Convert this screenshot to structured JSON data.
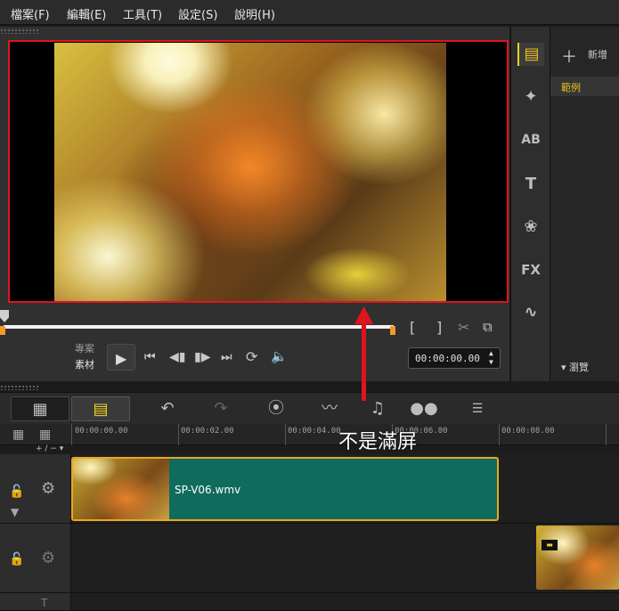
{
  "menu": {
    "file": "檔案(F)",
    "edit": "編輯(E)",
    "tools": "工具(T)",
    "settings": "設定(S)",
    "help": "說明(H)"
  },
  "player": {
    "mode_project": "專案",
    "mode_clip": "素材",
    "timecode": "00:00:00.00",
    "trim_start": "[",
    "trim_end": "]"
  },
  "library": {
    "add_label": "新增",
    "sample_label": "範例",
    "browse_label": "瀏覽"
  },
  "timeline": {
    "ticks": [
      "00:00:00.00",
      "00:00:02.00",
      "00:00:04.00",
      "00:00:06.00",
      "00:00:08.00"
    ],
    "clip_name": "SP-V06.wmv",
    "zoom_controls": "+ / − ▾"
  },
  "annotation": {
    "text": "不是滿屏",
    "highlight_color": "#e0141c"
  },
  "colors": {
    "accent": "#f0d028",
    "clip_fill": "#0f6b5e",
    "clip_border": "#e8a820"
  }
}
